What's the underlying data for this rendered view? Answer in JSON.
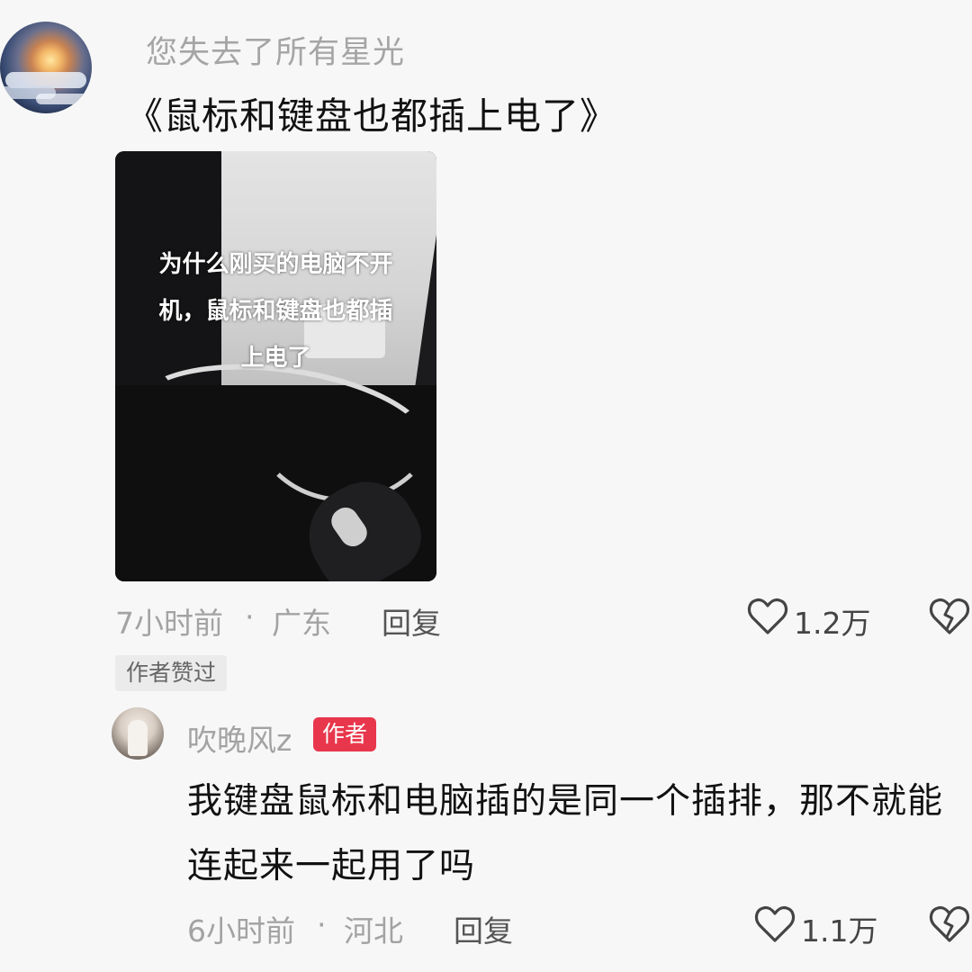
{
  "comment": {
    "username": "您失去了所有星光",
    "text": "《鼠标和键盘也都插上电了》",
    "image_overlay_lines": [
      "为什么刚买的电脑不开",
      "机，鼠标和键盘也都插",
      "上电了"
    ],
    "time": "7小时前",
    "dot": "·",
    "location": "广东",
    "reply_label": "回复",
    "likes": "1.2万",
    "author_liked_label": "作者赞过"
  },
  "reply": {
    "username": "吹晚风z",
    "badge": "作者",
    "text": "我键盘鼠标和电脑插的是同一个插排，那不就能连起来一起用了吗",
    "time": "6小时前",
    "dot": "·",
    "location": "河北",
    "reply_label": "回复",
    "likes": "1.1万"
  },
  "icons": {
    "like": "heart-outline-icon",
    "dislike": "broken-heart-icon"
  },
  "colors": {
    "author_badge": "#e8374c",
    "meta_text": "#a3a3a3",
    "background": "#f7f7f7"
  }
}
